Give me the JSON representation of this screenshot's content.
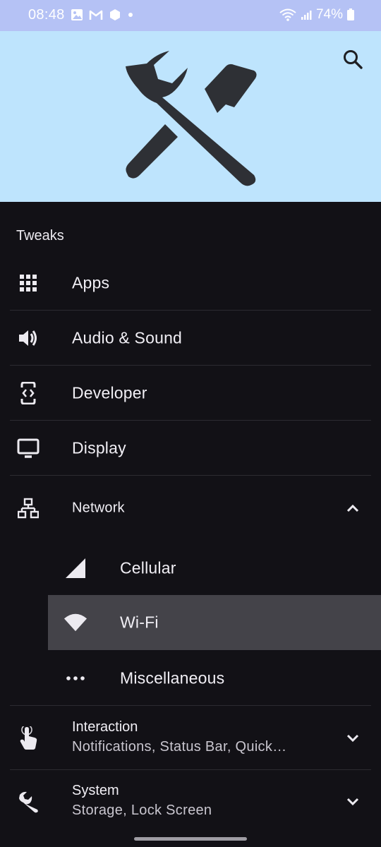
{
  "status_bar": {
    "time": "08:48",
    "battery": "74%",
    "background": "#B5C2F5"
  },
  "header": {
    "background": "#BEE4FD",
    "hero_icon": "tools-icon",
    "search_icon": "search-icon"
  },
  "section": {
    "title": "Tweaks"
  },
  "items": [
    {
      "label": "Apps",
      "icon": "apps-grid-icon"
    },
    {
      "label": "Audio & Sound",
      "icon": "volume-icon"
    },
    {
      "label": "Developer",
      "icon": "developer-mode-icon"
    },
    {
      "label": "Display",
      "icon": "monitor-icon"
    }
  ],
  "network": {
    "label": "Network",
    "icon": "network-icon",
    "expanded": true,
    "children": [
      {
        "label": "Cellular",
        "icon": "signal-cellular-icon"
      },
      {
        "label": "Wi-Fi",
        "icon": "wifi-icon",
        "selected": true
      },
      {
        "label": "Miscellaneous",
        "icon": "more-horiz-icon"
      }
    ]
  },
  "interaction": {
    "title": "Interaction",
    "subtitle": "Notifications, Status Bar, Quick…",
    "icon": "touch-app-icon"
  },
  "system": {
    "title": "System",
    "subtitle": "Storage, Lock Screen",
    "icon": "wrench-icon"
  },
  "colors": {
    "background": "#121116",
    "selected": "#444349",
    "text": "#F1EFF5"
  }
}
